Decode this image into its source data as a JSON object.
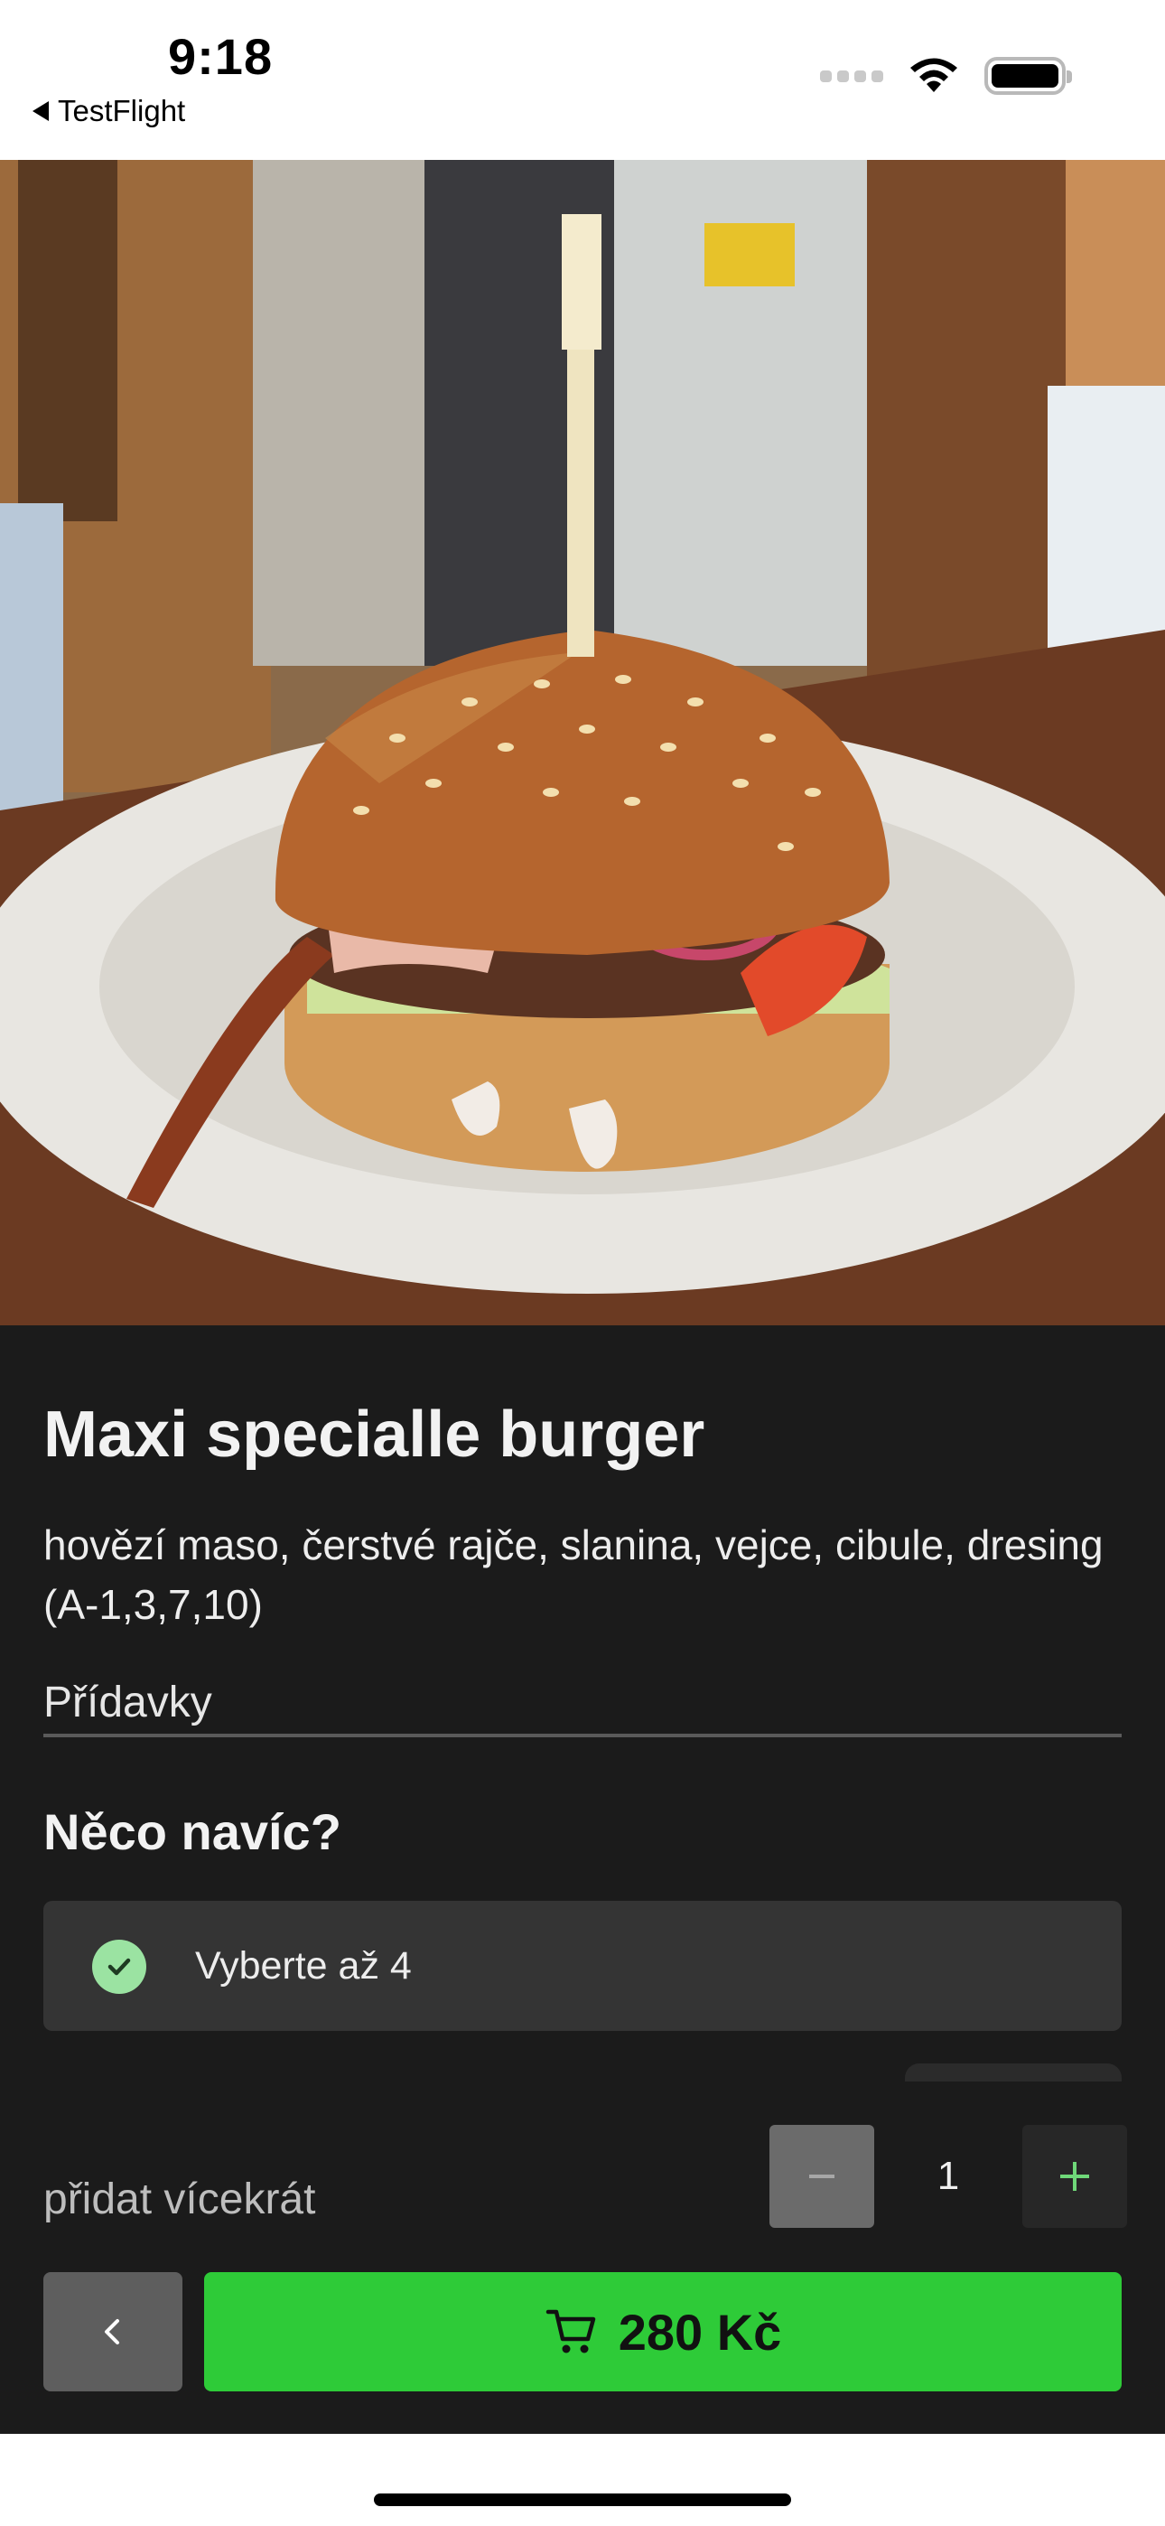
{
  "status_bar": {
    "time": "9:18",
    "back_app_label": "TestFlight",
    "icons": [
      "signal-icon",
      "wifi-icon",
      "battery-icon"
    ]
  },
  "product": {
    "image_alt": "burger-photo",
    "name": "Maxi specialle burger",
    "description": "hovězí maso, čerstvé rajče, slanina, vejce, cibule, dresing (A-1,3,7,10)"
  },
  "addons": {
    "label": "Přídavky",
    "section_title": "Něco navíc?",
    "choice_label": "Vyberte až 4"
  },
  "quantity": {
    "label": "přidat vícekrát",
    "value": "1"
  },
  "actions": {
    "back_icon": "chevron-left-icon",
    "cart_icon": "cart-icon",
    "cart_price": "280 Kč"
  },
  "colors": {
    "panel_bg": "#1b1b1b",
    "accent_green": "#2ecb38",
    "check_green": "#9be3a2",
    "plus_green": "#6fd879"
  }
}
